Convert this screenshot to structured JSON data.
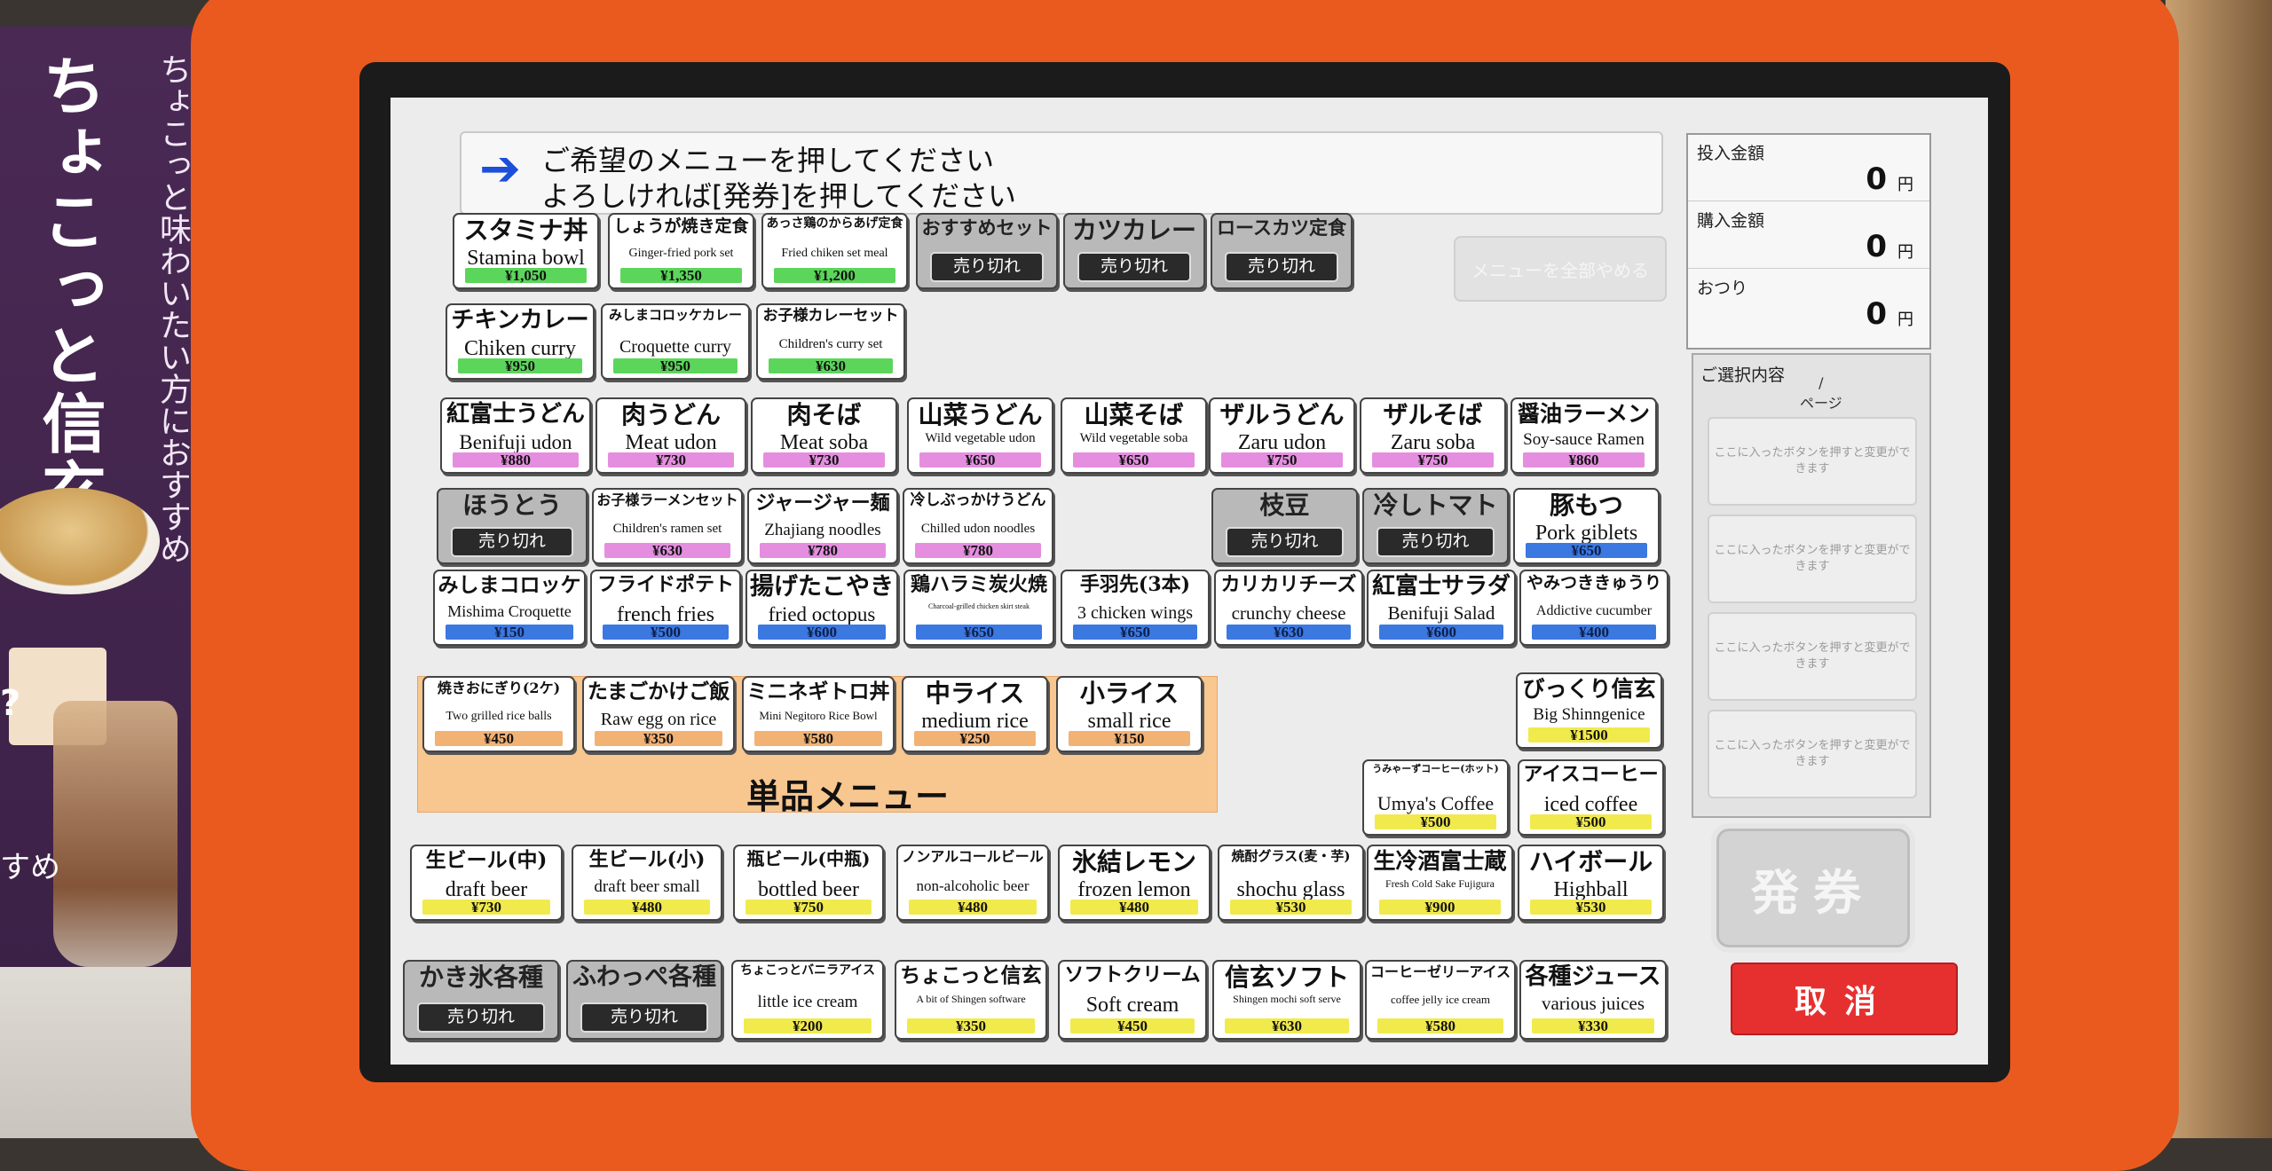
{
  "poster": {
    "title": "ちょこっと信玄",
    "subtitle": "ちょこっと味わいたい方におすすめ",
    "question": "?",
    "bottom_text": "すめ"
  },
  "instructions": {
    "line1": "ご希望のメニューを押してください",
    "line2": "よろしければ[発券]を押してください"
  },
  "clear_all_label": "メニューを全部やめる",
  "sold_out_label": "売り切れ",
  "tanpin_label": "単品メニュー",
  "money": {
    "inserted_label": "投入金額",
    "inserted_value": "0",
    "purchase_label": "購入金額",
    "purchase_value": "0",
    "change_label": "おつり",
    "change_value": "0",
    "unit": "円"
  },
  "selection": {
    "title": "ご選択内容",
    "page": "/\nページ",
    "slot_text": "ここに入ったボタンを押すと変更ができます"
  },
  "issue_label": "発券",
  "cancel_label": "取消",
  "items": [
    {
      "jp": "スタミナ丼",
      "en": "Stamina bowl",
      "price": "¥1,050",
      "color": "p-green"
    },
    {
      "jp": "しょうが焼き定食",
      "en": "Ginger-fried pork set",
      "price": "¥1,350",
      "color": "p-green"
    },
    {
      "jp": "あっさ鶏のからあげ定食",
      "en": "Fried chiken set meal",
      "price": "¥1,200",
      "color": "p-green"
    },
    {
      "jp": "おすすめセット",
      "en": "",
      "price": "",
      "sold": true
    },
    {
      "jp": "カツカレー",
      "en": "",
      "price": "",
      "sold": true
    },
    {
      "jp": "ロースカツ定食",
      "en": "",
      "price": "",
      "sold": true
    },
    {
      "jp": "チキンカレー",
      "en": "Chiken curry",
      "price": "¥950",
      "color": "p-green"
    },
    {
      "jp": "みしまコロッケカレー",
      "en": "Croquette curry",
      "price": "¥950",
      "color": "p-green"
    },
    {
      "jp": "お子様カレーセット",
      "en": "Children's curry set",
      "price": "¥630",
      "color": "p-green"
    },
    {
      "jp": "紅富士うどん",
      "en": "Benifuji udon",
      "price": "¥880",
      "color": "p-pink"
    },
    {
      "jp": "肉うどん",
      "en": "Meat udon",
      "price": "¥730",
      "color": "p-pink"
    },
    {
      "jp": "肉そば",
      "en": "Meat soba",
      "price": "¥730",
      "color": "p-pink"
    },
    {
      "jp": "山菜うどん",
      "en": "Wild vegetable udon",
      "price": "¥650",
      "color": "p-pink"
    },
    {
      "jp": "山菜そば",
      "en": "Wild vegetable soba",
      "price": "¥650",
      "color": "p-pink"
    },
    {
      "jp": "ザルうどん",
      "en": "Zaru udon",
      "price": "¥750",
      "color": "p-pink"
    },
    {
      "jp": "ザルそば",
      "en": "Zaru soba",
      "price": "¥750",
      "color": "p-pink"
    },
    {
      "jp": "醤油ラーメン",
      "en": "Soy-sauce Ramen",
      "price": "¥860",
      "color": "p-pink"
    },
    {
      "jp": "ほうとう",
      "en": "",
      "price": "",
      "sold": true
    },
    {
      "jp": "お子様ラーメンセット",
      "en": "Children's ramen set",
      "price": "¥630",
      "color": "p-pink"
    },
    {
      "jp": "ジャージャー麺",
      "en": "Zhajiang noodles",
      "price": "¥780",
      "color": "p-pink"
    },
    {
      "jp": "冷しぶっかけうどん",
      "en": "Chilled udon noodles",
      "price": "¥780",
      "color": "p-pink"
    },
    {
      "jp": "枝豆",
      "en": "",
      "price": "",
      "sold": true
    },
    {
      "jp": "冷しトマト",
      "en": "",
      "price": "",
      "sold": true
    },
    {
      "jp": "豚もつ",
      "en": "Pork giblets",
      "price": "¥650",
      "color": "p-blue"
    },
    {
      "jp": "みしまコロッケ",
      "en": "Mishima Croquette",
      "price": "¥150",
      "color": "p-blue"
    },
    {
      "jp": "フライドポテト",
      "en": "french fries",
      "price": "¥500",
      "color": "p-blue"
    },
    {
      "jp": "揚げたこやき",
      "en": "fried octopus",
      "price": "¥600",
      "color": "p-blue"
    },
    {
      "jp": "鶏ハラミ炭火焼",
      "en": "Charcoal-grilled chicken skirt steak",
      "price": "¥650",
      "color": "p-blue"
    },
    {
      "jp": "手羽先(3本)",
      "en": "3 chicken wings",
      "price": "¥650",
      "color": "p-blue"
    },
    {
      "jp": "カリカリチーズ",
      "en": "crunchy cheese",
      "price": "¥630",
      "color": "p-blue"
    },
    {
      "jp": "紅富士サラダ",
      "en": "Benifuji Salad",
      "price": "¥600",
      "color": "p-blue"
    },
    {
      "jp": "やみつききゅうり",
      "en": "Addictive cucumber",
      "price": "¥400",
      "color": "p-blue"
    },
    {
      "jp": "焼きおにぎり(2ケ)",
      "en": "Two grilled rice balls",
      "price": "¥450",
      "color": "p-orange"
    },
    {
      "jp": "たまごかけご飯",
      "en": "Raw egg on rice",
      "price": "¥350",
      "color": "p-orange"
    },
    {
      "jp": "ミニネギトロ丼",
      "en": "Mini Negitoro Rice Bowl",
      "price": "¥580",
      "color": "p-orange"
    },
    {
      "jp": "中ライス",
      "en": "medium rice",
      "price": "¥250",
      "color": "p-orange"
    },
    {
      "jp": "小ライス",
      "en": "small rice",
      "price": "¥150",
      "color": "p-orange"
    },
    {
      "jp": "びっくり信玄",
      "en": "Big Shinngenice",
      "price": "¥1500",
      "color": "p-yellow"
    },
    {
      "jp": "うみゃーずコーヒー(ホット)",
      "en": "Umya's Coffee",
      "price": "¥500",
      "color": "p-yellow"
    },
    {
      "jp": "アイスコーヒー",
      "en": "iced coffee",
      "price": "¥500",
      "color": "p-yellow"
    },
    {
      "jp": "生ビール(中)",
      "en": "draft beer",
      "price": "¥730",
      "color": "p-yellow"
    },
    {
      "jp": "生ビール(小)",
      "en": "draft beer small",
      "price": "¥480",
      "color": "p-yellow"
    },
    {
      "jp": "瓶ビール(中瓶)",
      "en": "bottled beer",
      "price": "¥750",
      "color": "p-yellow"
    },
    {
      "jp": "ノンアルコールビール",
      "en": "non-alcoholic beer",
      "price": "¥480",
      "color": "p-yellow"
    },
    {
      "jp": "氷結レモン",
      "en": "frozen lemon",
      "price": "¥480",
      "color": "p-yellow"
    },
    {
      "jp": "焼酎グラス(麦・芋)",
      "en": "shochu glass",
      "price": "¥530",
      "color": "p-yellow"
    },
    {
      "jp": "生冷酒富士蔵",
      "en": "Fresh Cold Sake Fujigura",
      "price": "¥900",
      "color": "p-yellow"
    },
    {
      "jp": "ハイボール",
      "en": "Highball",
      "price": "¥530",
      "color": "p-yellow"
    },
    {
      "jp": "かき氷各種",
      "en": "",
      "price": "",
      "sold": true
    },
    {
      "jp": "ふわっぺ各種",
      "en": "",
      "price": "",
      "sold": true
    },
    {
      "jp": "ちょこっとバニラアイス",
      "en": "little ice cream",
      "price": "¥200",
      "color": "p-yellow"
    },
    {
      "jp": "ちょこっと信玄",
      "en": "A bit of Shingen software",
      "price": "¥350",
      "color": "p-yellow"
    },
    {
      "jp": "ソフトクリーム",
      "en": "Soft cream",
      "price": "¥450",
      "color": "p-yellow"
    },
    {
      "jp": "信玄ソフト",
      "en": "Shingen mochi soft serve",
      "price": "¥630",
      "color": "p-yellow"
    },
    {
      "jp": "コーヒーゼリーアイス",
      "en": "coffee jelly ice cream",
      "price": "¥580",
      "color": "p-yellow"
    },
    {
      "jp": "各種ジュース",
      "en": "various juices",
      "price": "¥330",
      "color": "p-yellow"
    }
  ]
}
